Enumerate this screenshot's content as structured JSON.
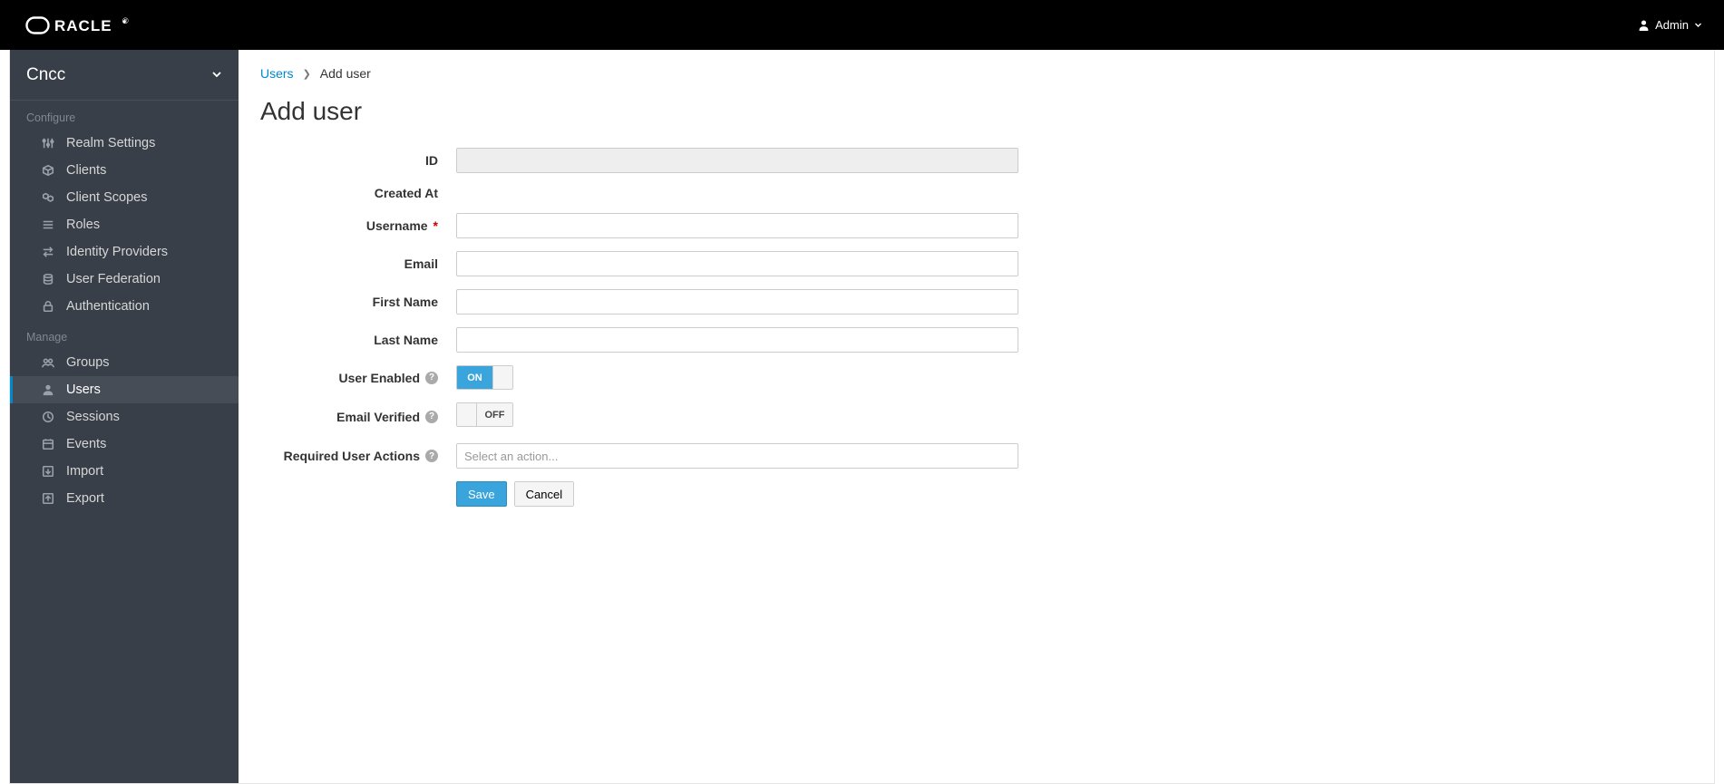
{
  "header": {
    "brand": "ORACLE",
    "user_label": "Admin"
  },
  "sidebar": {
    "realm": "Cncc",
    "sections": [
      {
        "label": "Configure",
        "items": [
          {
            "icon": "sliders-icon",
            "label": "Realm Settings"
          },
          {
            "icon": "cube-icon",
            "label": "Clients"
          },
          {
            "icon": "cubes-icon",
            "label": "Client Scopes"
          },
          {
            "icon": "list-icon",
            "label": "Roles"
          },
          {
            "icon": "exchange-icon",
            "label": "Identity Providers"
          },
          {
            "icon": "database-icon",
            "label": "User Federation"
          },
          {
            "icon": "lock-icon",
            "label": "Authentication"
          }
        ]
      },
      {
        "label": "Manage",
        "items": [
          {
            "icon": "group-icon",
            "label": "Groups"
          },
          {
            "icon": "user-icon",
            "label": "Users",
            "active": true
          },
          {
            "icon": "clock-icon",
            "label": "Sessions"
          },
          {
            "icon": "calendar-icon",
            "label": "Events"
          },
          {
            "icon": "import-icon",
            "label": "Import"
          },
          {
            "icon": "export-icon",
            "label": "Export"
          }
        ]
      }
    ]
  },
  "breadcrumb": {
    "parent_label": "Users",
    "current_label": "Add user"
  },
  "page": {
    "title": "Add user"
  },
  "form": {
    "id": {
      "label": "ID",
      "value": ""
    },
    "created_at": {
      "label": "Created At",
      "value": ""
    },
    "username": {
      "label": "Username",
      "value": "",
      "required": true
    },
    "email": {
      "label": "Email",
      "value": ""
    },
    "first_name": {
      "label": "First Name",
      "value": ""
    },
    "last_name": {
      "label": "Last Name",
      "value": ""
    },
    "user_enabled": {
      "label": "User Enabled",
      "value": "ON",
      "help": true
    },
    "email_verified": {
      "label": "Email Verified",
      "value": "OFF",
      "help": true
    },
    "required_actions": {
      "label": "Required User Actions",
      "placeholder": "Select an action...",
      "help": true
    }
  },
  "buttons": {
    "save": "Save",
    "cancel": "Cancel"
  },
  "icons": {
    "sliders-icon": "sliders",
    "cube-icon": "cube",
    "cubes-icon": "cubes",
    "list-icon": "list",
    "exchange-icon": "exchange",
    "database-icon": "database",
    "lock-icon": "lock",
    "group-icon": "group",
    "user-icon": "user",
    "clock-icon": "clock",
    "calendar-icon": "calendar",
    "import-icon": "import",
    "export-icon": "export",
    "chevron-down-icon": "chevron-down",
    "user-solid-icon": "user-solid",
    "help-icon": "help",
    "angle-right-icon": "angle-right"
  }
}
